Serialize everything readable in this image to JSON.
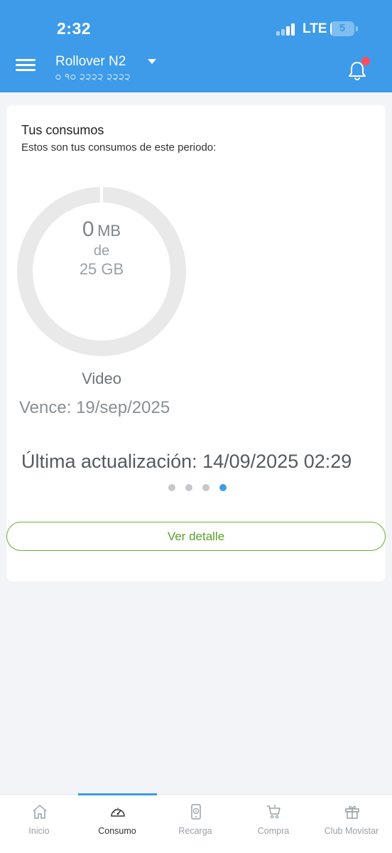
{
  "status_bar": {
    "time": "2:32",
    "network": "LTE",
    "battery": "5",
    "battery_level_percent": 5
  },
  "header": {
    "plan_name": "Rollover N2",
    "phone_number": "੦ ੧੦ ੨੨੨੨ ੨੨੨੨",
    "has_notification": true
  },
  "card": {
    "title": "Tus consumos",
    "subtitle": "Estos son tus consumos de este periodo:",
    "usage": {
      "used_value": "0",
      "used_unit": "MB",
      "connector": "de",
      "total": "25 GB",
      "used_fraction": 0
    },
    "category": "Video",
    "expiry": "Vence: 19/sep/2025",
    "last_update": "Última actualización: 14/09/2025 02:29",
    "carousel": {
      "count": 4,
      "active_index": 3
    },
    "detail_button": "Ver detalle"
  },
  "bottom_nav": {
    "active_index": 1,
    "items": [
      {
        "label": "Inicio",
        "icon": "home-icon"
      },
      {
        "label": "Consumo",
        "icon": "gauge-icon"
      },
      {
        "label": "Recarga",
        "icon": "phone-dollar-icon"
      },
      {
        "label": "Compra",
        "icon": "cart-icon"
      },
      {
        "label": "Club Movistar",
        "icon": "gift-icon"
      }
    ]
  },
  "colors": {
    "header_blue": "#3d9be9",
    "accent_green": "#6cae2f",
    "notification_red": "#ff4d5e",
    "dot_active": "#3d9be9",
    "dot_inactive": "#c4c8cc",
    "donut_track": "#e9e9e9"
  }
}
